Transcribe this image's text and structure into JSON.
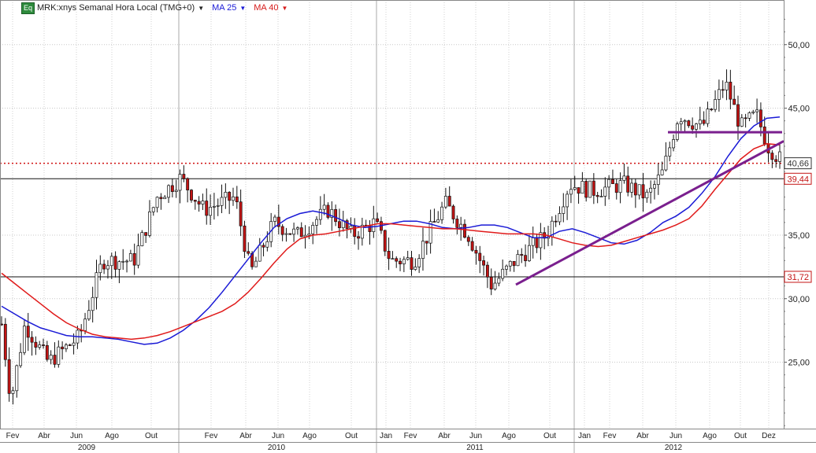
{
  "legend": {
    "badge": "Eq",
    "instrument": "MRK:xnys Semanal Hora Local (TMG+0)",
    "ma25_label": "MA 25",
    "ma40_label": "MA 40"
  },
  "colors": {
    "up_candle": "#ffffff",
    "down_candle": "#c41414",
    "ma25": "#1a1ad6",
    "ma40": "#e01a1a",
    "trendline": "#7a1f8e",
    "grid": "#cfcfcf"
  },
  "price_labels": {
    "current": "40,66",
    "level_high": "39,44",
    "level_low": "31,72"
  },
  "y_ticks": [
    "50,00",
    "45,00",
    "35,00",
    "30,00",
    "25,00"
  ],
  "x_months": [
    "Fev",
    "Abr",
    "Jun",
    "Ago",
    "Out",
    "Fev",
    "Abr",
    "Jun",
    "Ago",
    "Out",
    "Jan",
    "Fev",
    "Abr",
    "Jun",
    "Ago",
    "Out",
    "Jan",
    "Fev",
    "Abr",
    "Jun",
    "Ago",
    "Out",
    "Dez"
  ],
  "x_years": [
    "2009",
    "2010",
    "2011",
    "2012"
  ],
  "chart_data": {
    "type": "candlestick",
    "title": "MRK:xnys Semanal Hora Local (TMG+0)",
    "ylim": [
      19.5,
      52.5
    ],
    "series": [
      {
        "name": "MA 25",
        "type": "line",
        "values": [
          29.4,
          28.8,
          28.2,
          27.7,
          27.4,
          27.1,
          27.0,
          27.0,
          26.9,
          26.8,
          26.6,
          26.4,
          26.5,
          26.9,
          27.5,
          28.3,
          29.3,
          30.5,
          31.8,
          33.1,
          34.4,
          35.6,
          36.3,
          36.7,
          36.9,
          36.7,
          36.3,
          35.8,
          35.6,
          35.7,
          35.9,
          36.1,
          36.1,
          35.9,
          35.6,
          35.5,
          35.6,
          35.8,
          35.8,
          35.6,
          35.2,
          34.8,
          34.8,
          35.3,
          35.5,
          35.2,
          34.8,
          34.4,
          34.3,
          34.6,
          35.2,
          36.0,
          36.5,
          37.2,
          38.3,
          39.6,
          41.2,
          42.6,
          43.6,
          44.2,
          44.3
        ]
      },
      {
        "name": "MA 40",
        "type": "line",
        "values": [
          32.0,
          31.2,
          30.4,
          29.6,
          28.8,
          28.1,
          27.6,
          27.2,
          27.0,
          26.9,
          26.8,
          26.9,
          27.1,
          27.4,
          27.8,
          28.2,
          28.6,
          29.0,
          29.6,
          30.5,
          31.6,
          32.8,
          33.9,
          34.7,
          35.0,
          35.1,
          35.3,
          35.5,
          35.7,
          35.9,
          35.9,
          35.8,
          35.7,
          35.6,
          35.5,
          35.5,
          35.4,
          35.3,
          35.2,
          35.1,
          35.1,
          35.1,
          35.0,
          34.7,
          34.4,
          34.2,
          34.1,
          34.2,
          34.5,
          34.8,
          35.1,
          35.4,
          35.8,
          36.3,
          37.3,
          38.6,
          39.8,
          41.0,
          41.8,
          42.2,
          42.1
        ]
      },
      {
        "name": "Trendline",
        "type": "annotation",
        "values": [
          31.1,
          42.4
        ]
      },
      {
        "name": "Resistance",
        "type": "annotation",
        "values": [
          43.1
        ]
      },
      {
        "name": "Current price",
        "type": "annotation",
        "values": [
          40.66
        ]
      },
      {
        "name": "Level",
        "type": "annotation",
        "values": [
          39.44,
          31.72
        ]
      }
    ],
    "x_range": [
      "2009-01",
      "2012-12"
    ]
  }
}
